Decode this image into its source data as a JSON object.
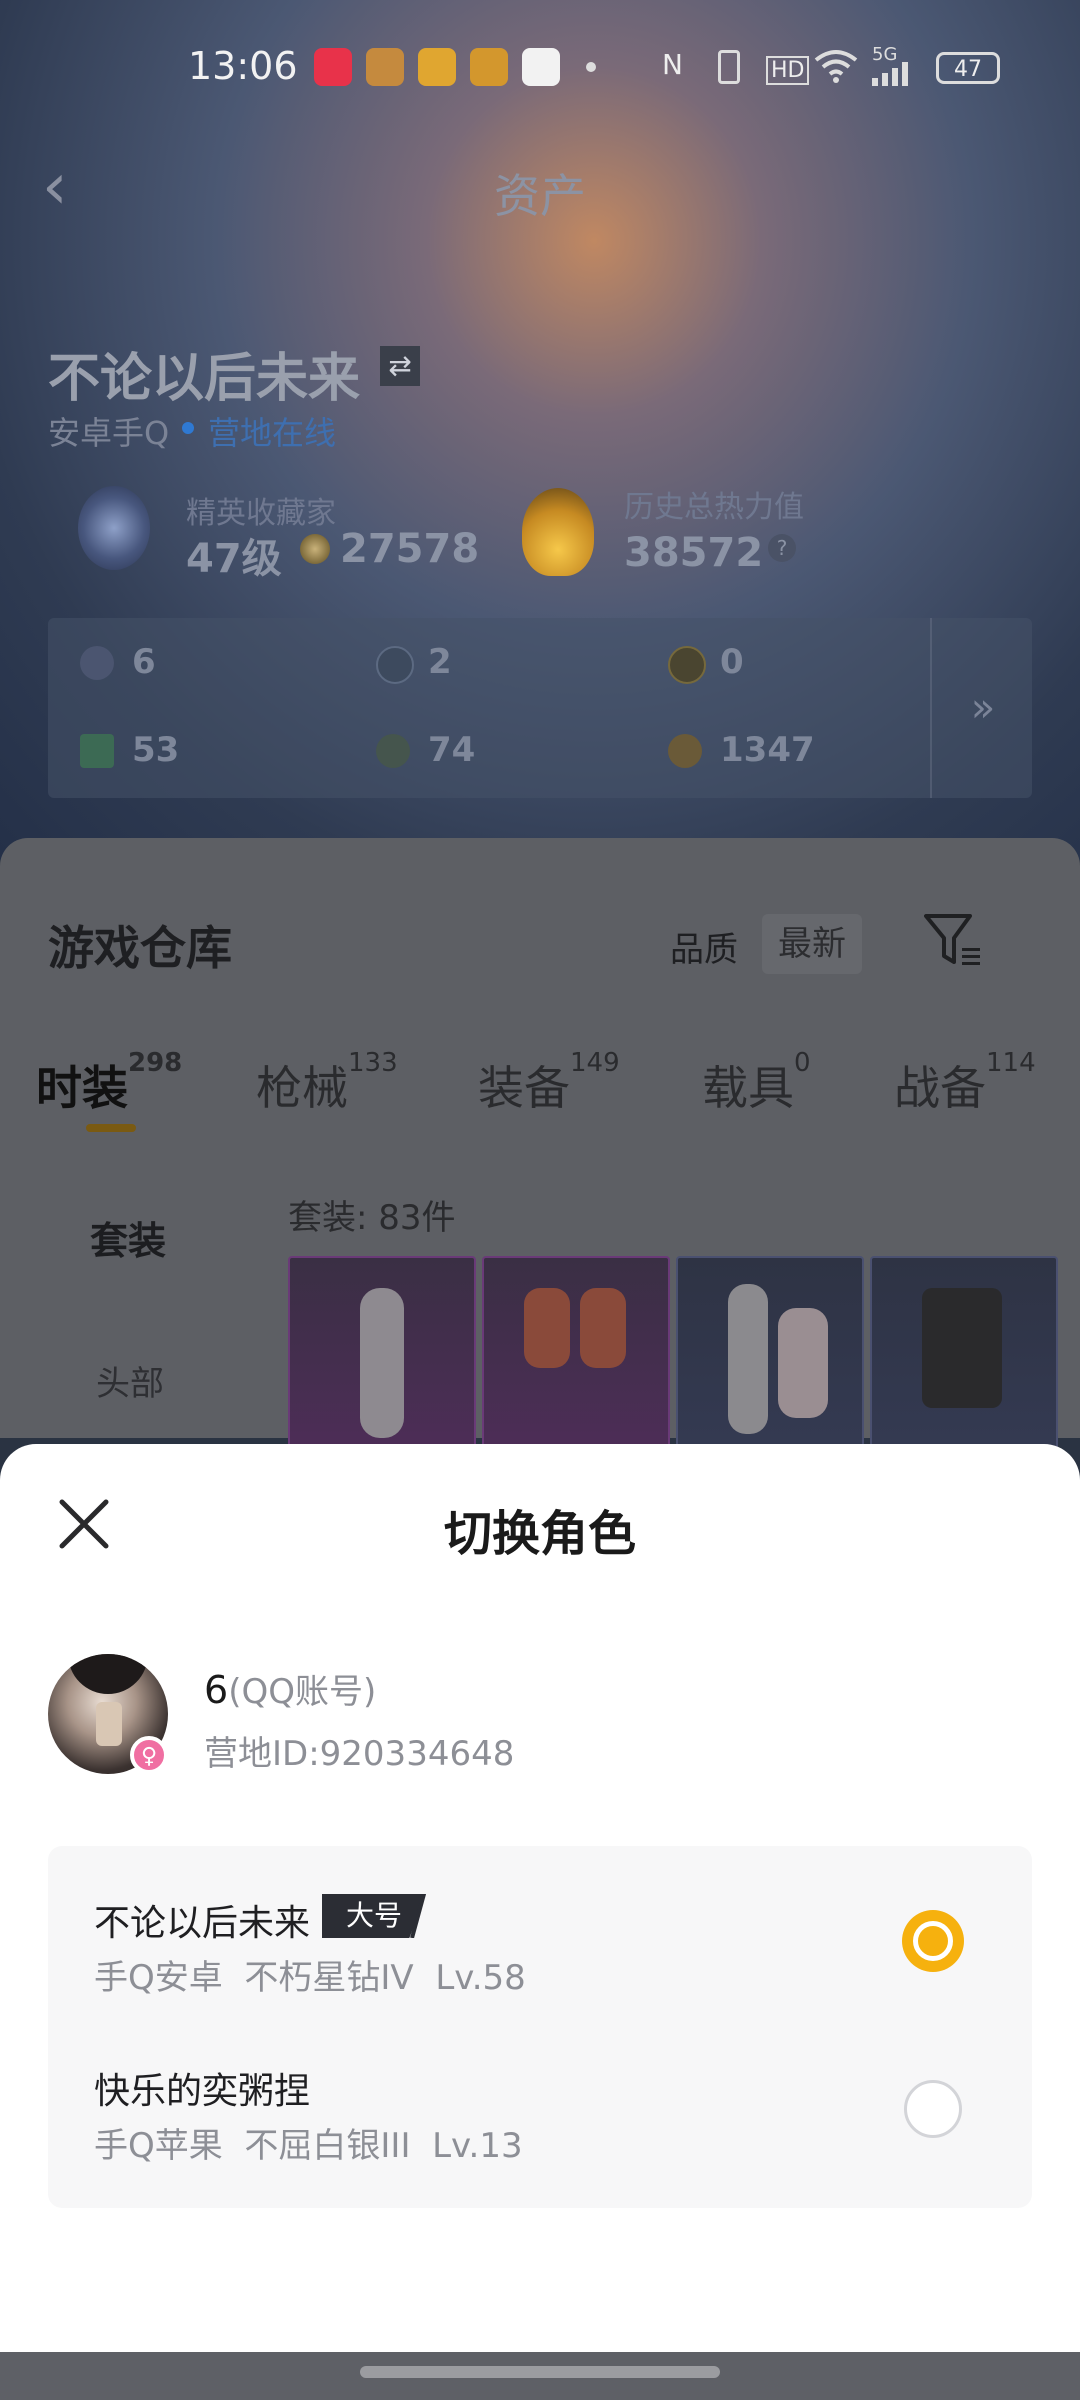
{
  "status_bar": {
    "time": "13:06",
    "network": "5G",
    "battery": "47",
    "hd": "HD"
  },
  "header": {
    "back_icon": "chevron-left-icon",
    "title": "资产"
  },
  "profile": {
    "name": "不论以后未来",
    "platform": "安卓手Q",
    "camp_status": "营地在线",
    "collector": {
      "label": "精英收藏家",
      "level": "47级",
      "coins": "27578"
    },
    "heat": {
      "label": "历史总热力值",
      "value": "38572",
      "help": "?"
    }
  },
  "stats": {
    "row1": [
      "6",
      "2",
      "0"
    ],
    "row2": [
      "53",
      "74",
      "1347"
    ],
    "more": "»"
  },
  "warehouse": {
    "title": "游戏仓库",
    "sort_quality": "品质",
    "sort_newest": "最新",
    "tabs": [
      {
        "label": "时装",
        "count": "298"
      },
      {
        "label": "枪械",
        "count": "133"
      },
      {
        "label": "装备",
        "count": "149"
      },
      {
        "label": "载具",
        "count": "0"
      },
      {
        "label": "战备",
        "count": "114"
      }
    ],
    "sidebar": [
      "套装",
      "头部"
    ],
    "suit_count": "套装: 83件"
  },
  "sheet": {
    "title": "切换角色",
    "account": {
      "name": "6",
      "type": "(QQ账号)",
      "camp_id": "营地ID:920334648",
      "gender_icon": "female-icon"
    },
    "roles": [
      {
        "name": "不论以后未来",
        "tag": "大号",
        "platform": "手Q安卓",
        "rank": "不朽星钻IV",
        "level": "Lv.58",
        "selected": true
      },
      {
        "name": "快乐的奕粥捏",
        "tag": "",
        "platform": "手Q苹果",
        "rank": "不屈白银III",
        "level": "Lv.13",
        "selected": false
      }
    ]
  },
  "colors": {
    "accent": "#f6b10e",
    "camp_blue": "#2f79d2"
  }
}
